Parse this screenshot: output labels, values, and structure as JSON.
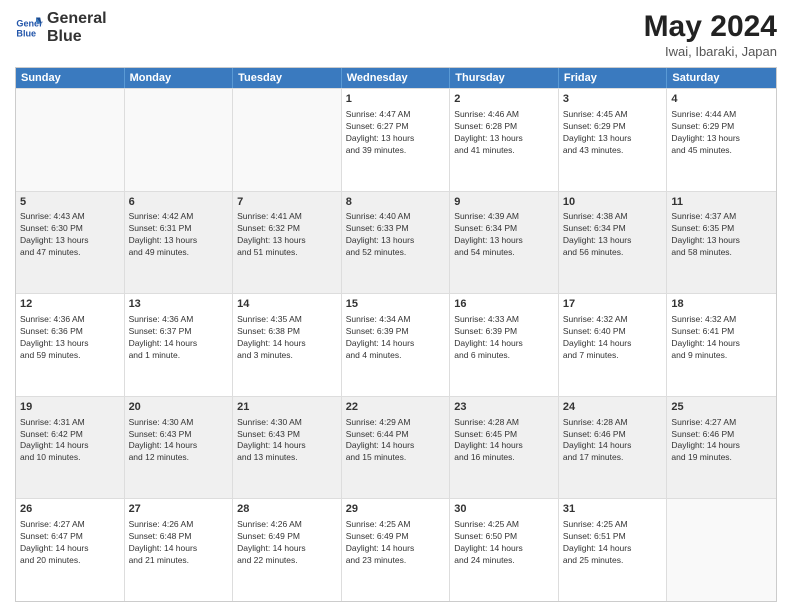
{
  "logo": {
    "line1": "General",
    "line2": "Blue"
  },
  "title": "May 2024",
  "location": "Iwai, Ibaraki, Japan",
  "header": {
    "days": [
      "Sunday",
      "Monday",
      "Tuesday",
      "Wednesday",
      "Thursday",
      "Friday",
      "Saturday"
    ]
  },
  "rows": [
    [
      {
        "day": "",
        "info": ""
      },
      {
        "day": "",
        "info": ""
      },
      {
        "day": "",
        "info": ""
      },
      {
        "day": "1",
        "info": "Sunrise: 4:47 AM\nSunset: 6:27 PM\nDaylight: 13 hours\nand 39 minutes."
      },
      {
        "day": "2",
        "info": "Sunrise: 4:46 AM\nSunset: 6:28 PM\nDaylight: 13 hours\nand 41 minutes."
      },
      {
        "day": "3",
        "info": "Sunrise: 4:45 AM\nSunset: 6:29 PM\nDaylight: 13 hours\nand 43 minutes."
      },
      {
        "day": "4",
        "info": "Sunrise: 4:44 AM\nSunset: 6:29 PM\nDaylight: 13 hours\nand 45 minutes."
      }
    ],
    [
      {
        "day": "5",
        "info": "Sunrise: 4:43 AM\nSunset: 6:30 PM\nDaylight: 13 hours\nand 47 minutes."
      },
      {
        "day": "6",
        "info": "Sunrise: 4:42 AM\nSunset: 6:31 PM\nDaylight: 13 hours\nand 49 minutes."
      },
      {
        "day": "7",
        "info": "Sunrise: 4:41 AM\nSunset: 6:32 PM\nDaylight: 13 hours\nand 51 minutes."
      },
      {
        "day": "8",
        "info": "Sunrise: 4:40 AM\nSunset: 6:33 PM\nDaylight: 13 hours\nand 52 minutes."
      },
      {
        "day": "9",
        "info": "Sunrise: 4:39 AM\nSunset: 6:34 PM\nDaylight: 13 hours\nand 54 minutes."
      },
      {
        "day": "10",
        "info": "Sunrise: 4:38 AM\nSunset: 6:34 PM\nDaylight: 13 hours\nand 56 minutes."
      },
      {
        "day": "11",
        "info": "Sunrise: 4:37 AM\nSunset: 6:35 PM\nDaylight: 13 hours\nand 58 minutes."
      }
    ],
    [
      {
        "day": "12",
        "info": "Sunrise: 4:36 AM\nSunset: 6:36 PM\nDaylight: 13 hours\nand 59 minutes."
      },
      {
        "day": "13",
        "info": "Sunrise: 4:36 AM\nSunset: 6:37 PM\nDaylight: 14 hours\nand 1 minute."
      },
      {
        "day": "14",
        "info": "Sunrise: 4:35 AM\nSunset: 6:38 PM\nDaylight: 14 hours\nand 3 minutes."
      },
      {
        "day": "15",
        "info": "Sunrise: 4:34 AM\nSunset: 6:39 PM\nDaylight: 14 hours\nand 4 minutes."
      },
      {
        "day": "16",
        "info": "Sunrise: 4:33 AM\nSunset: 6:39 PM\nDaylight: 14 hours\nand 6 minutes."
      },
      {
        "day": "17",
        "info": "Sunrise: 4:32 AM\nSunset: 6:40 PM\nDaylight: 14 hours\nand 7 minutes."
      },
      {
        "day": "18",
        "info": "Sunrise: 4:32 AM\nSunset: 6:41 PM\nDaylight: 14 hours\nand 9 minutes."
      }
    ],
    [
      {
        "day": "19",
        "info": "Sunrise: 4:31 AM\nSunset: 6:42 PM\nDaylight: 14 hours\nand 10 minutes."
      },
      {
        "day": "20",
        "info": "Sunrise: 4:30 AM\nSunset: 6:43 PM\nDaylight: 14 hours\nand 12 minutes."
      },
      {
        "day": "21",
        "info": "Sunrise: 4:30 AM\nSunset: 6:43 PM\nDaylight: 14 hours\nand 13 minutes."
      },
      {
        "day": "22",
        "info": "Sunrise: 4:29 AM\nSunset: 6:44 PM\nDaylight: 14 hours\nand 15 minutes."
      },
      {
        "day": "23",
        "info": "Sunrise: 4:28 AM\nSunset: 6:45 PM\nDaylight: 14 hours\nand 16 minutes."
      },
      {
        "day": "24",
        "info": "Sunrise: 4:28 AM\nSunset: 6:46 PM\nDaylight: 14 hours\nand 17 minutes."
      },
      {
        "day": "25",
        "info": "Sunrise: 4:27 AM\nSunset: 6:46 PM\nDaylight: 14 hours\nand 19 minutes."
      }
    ],
    [
      {
        "day": "26",
        "info": "Sunrise: 4:27 AM\nSunset: 6:47 PM\nDaylight: 14 hours\nand 20 minutes."
      },
      {
        "day": "27",
        "info": "Sunrise: 4:26 AM\nSunset: 6:48 PM\nDaylight: 14 hours\nand 21 minutes."
      },
      {
        "day": "28",
        "info": "Sunrise: 4:26 AM\nSunset: 6:49 PM\nDaylight: 14 hours\nand 22 minutes."
      },
      {
        "day": "29",
        "info": "Sunrise: 4:25 AM\nSunset: 6:49 PM\nDaylight: 14 hours\nand 23 minutes."
      },
      {
        "day": "30",
        "info": "Sunrise: 4:25 AM\nSunset: 6:50 PM\nDaylight: 14 hours\nand 24 minutes."
      },
      {
        "day": "31",
        "info": "Sunrise: 4:25 AM\nSunset: 6:51 PM\nDaylight: 14 hours\nand 25 minutes."
      },
      {
        "day": "",
        "info": ""
      }
    ]
  ]
}
